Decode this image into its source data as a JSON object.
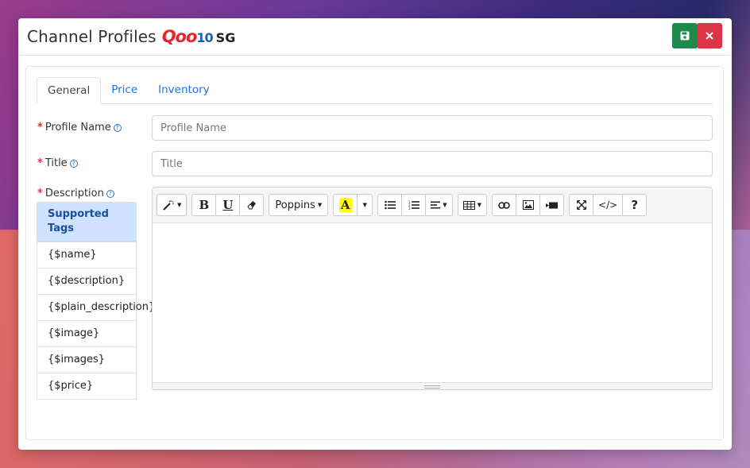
{
  "header": {
    "title": "Channel Profiles",
    "brand": {
      "logo_main": "Qoo",
      "logo_suffix": "10",
      "region": "SG"
    },
    "save_icon": "floppy-disk-icon",
    "close_icon": "close-icon"
  },
  "tabs": [
    {
      "label": "General",
      "active": true
    },
    {
      "label": "Price",
      "active": false
    },
    {
      "label": "Inventory",
      "active": false
    }
  ],
  "fields": {
    "profile_name": {
      "label": "Profile Name",
      "placeholder": "Profile Name",
      "value": ""
    },
    "title": {
      "label": "Title",
      "placeholder": "Title",
      "value": ""
    },
    "description": {
      "label": "Description"
    }
  },
  "required_marker": "*",
  "help_icon": "question-circle-icon",
  "supported_tags": {
    "heading": "Supported Tags",
    "items": [
      "{$name}",
      "{$description}",
      "{$plain_description}",
      "{$image}",
      "{$images}",
      "{$price}"
    ]
  },
  "editor": {
    "font_family_label": "Poppins",
    "toolbar_icons": [
      "magic-wand-icon",
      "bold-icon",
      "underline-icon",
      "eraser-icon",
      "font-family-dropdown",
      "text-color-icon",
      "color-dropdown-icon",
      "unordered-list-icon",
      "ordered-list-icon",
      "align-icon",
      "table-icon",
      "link-icon",
      "image-icon",
      "video-icon",
      "fullscreen-icon",
      "code-view-icon",
      "help-icon"
    ],
    "help_label": "?",
    "code_label": "</>"
  },
  "colors": {
    "save": "#1e8a4c",
    "close": "#dc3545",
    "tab_link": "#1a73e8",
    "tags_header_bg": "#cfe2ff",
    "highlight": "#ffff00"
  }
}
